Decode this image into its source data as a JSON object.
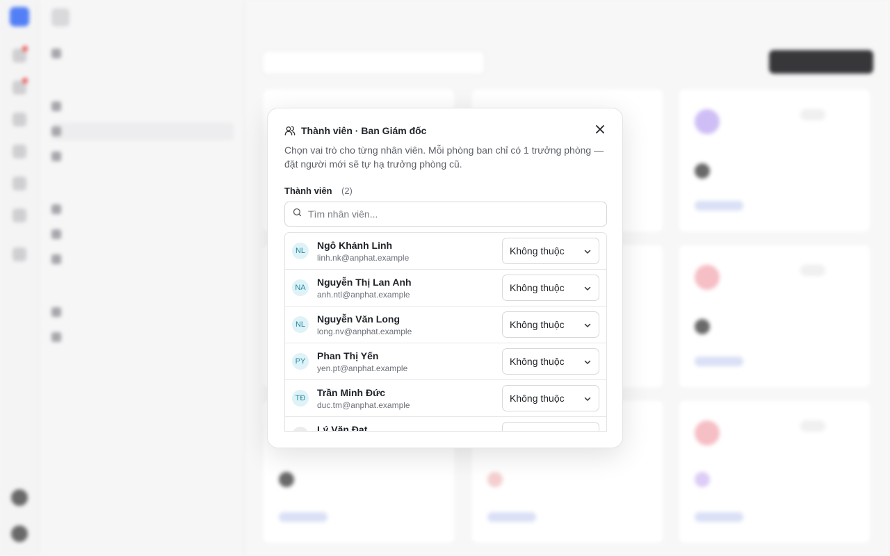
{
  "dialog": {
    "title": "Thành viên · Ban Giám đốc",
    "description": "Chọn vai trò cho từng nhân viên. Mỗi phòng ban chỉ có 1 trưởng phòng — đặt người mới sẽ tự hạ trưởng phòng cũ.",
    "members_label": "Thành viên",
    "members_count": "(2)",
    "search_placeholder": "Tìm nhân viên...",
    "rows": [
      {
        "initials": "NL",
        "name": "Ngô Khánh Linh",
        "email": "linh.nk@anphat.example",
        "role": "Không thuộc"
      },
      {
        "initials": "NA",
        "name": "Nguyễn Thị Lan Anh",
        "email": "anh.ntl@anphat.example",
        "role": "Không thuộc"
      },
      {
        "initials": "NL",
        "name": "Nguyễn Văn Long",
        "email": "long.nv@anphat.example",
        "role": "Không thuộc"
      },
      {
        "initials": "PY",
        "name": "Phan Thị Yến",
        "email": "yen.pt@anphat.example",
        "role": "Không thuộc"
      },
      {
        "initials": "TĐ",
        "name": "Trần Minh Đức",
        "email": "duc.tm@anphat.example",
        "role": "Không thuộc"
      },
      {
        "initials": "",
        "name": "Lý Văn Đạt",
        "email": "",
        "role": ""
      }
    ]
  },
  "icons": {
    "members": "users-icon",
    "close": "close-icon",
    "search": "search-icon",
    "dropdown": "chevron-down-icon"
  },
  "colors": {
    "avatar_bg": "#dff2f7",
    "avatar_text": "#1e8aa0",
    "brand": "#3b6ef5"
  }
}
